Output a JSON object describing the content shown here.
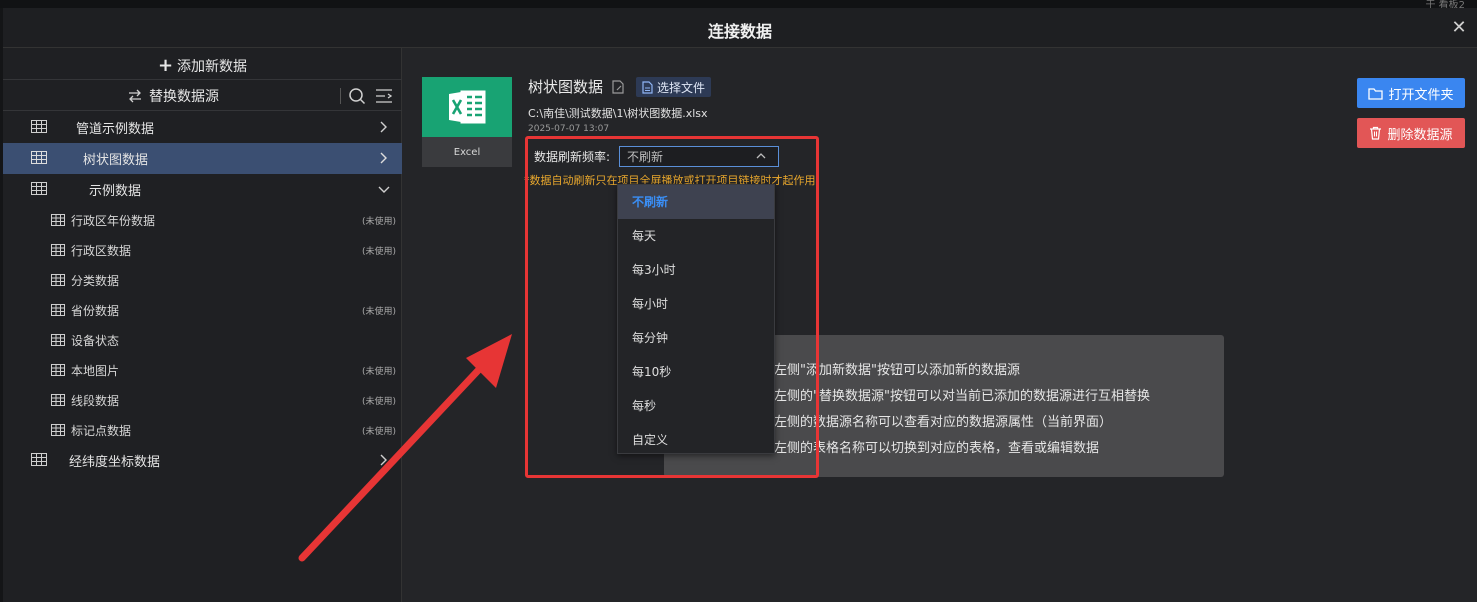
{
  "top_strip": {
    "corner_text": "于 看板2"
  },
  "modal": {
    "title": "连接数据",
    "close_icon": "close-icon"
  },
  "sidebar": {
    "add_label": "添加新数据",
    "swap_label": "替换数据源",
    "tree": [
      {
        "label": "管道示例数据",
        "expanded": false,
        "active": false
      },
      {
        "label": "树状图数据",
        "expanded": false,
        "active": true
      },
      {
        "label": "示例数据",
        "expanded": true,
        "active": false,
        "children": [
          {
            "label": "行政区年份数据",
            "tag": "(未使用)"
          },
          {
            "label": "行政区数据",
            "tag": "(未使用)"
          },
          {
            "label": "分类数据",
            "tag": ""
          },
          {
            "label": "省份数据",
            "tag": "(未使用)"
          },
          {
            "label": "设备状态",
            "tag": ""
          },
          {
            "label": "本地图片",
            "tag": "(未使用)"
          },
          {
            "label": "线段数据",
            "tag": "(未使用)"
          },
          {
            "label": "标记点数据",
            "tag": "(未使用)"
          }
        ]
      },
      {
        "label": "经纬度坐标数据",
        "expanded": false,
        "active": false
      }
    ]
  },
  "source": {
    "type_label": "Excel",
    "name": "树状图数据",
    "choose_file": "选择文件",
    "path": "C:\\南佳\\测试数据\\1\\树状图数据.xlsx",
    "time": "2025-07-07 13:07",
    "refresh_label": "数据刷新频率:",
    "refresh_value": "不刷新",
    "warning": "*数据自动刷新只在项目全屏播放或打开项目链接时才起作用"
  },
  "actions": {
    "open_folder": "打开文件夹",
    "delete_source": "删除数据源"
  },
  "hints": [
    "左侧\"添加新数据\"按钮可以添加新的数据源",
    "左侧的\"替换数据源\"按钮可以对当前已添加的数据源进行互相替换",
    "左侧的数据源名称可以查看对应的数据源属性（当前界面）",
    "左侧的表格名称可以切换到对应的表格，查看或编辑数据"
  ],
  "dropdown": {
    "options": [
      "不刷新",
      "每天",
      "每3小时",
      "每小时",
      "每分钟",
      "每10秒",
      "每秒",
      "自定义"
    ],
    "selected": "不刷新"
  },
  "colors": {
    "accent": "#3a86f0",
    "danger": "#e25656",
    "excel": "#18a373",
    "active_row": "#3b4f72",
    "annotation": "#e73535"
  }
}
